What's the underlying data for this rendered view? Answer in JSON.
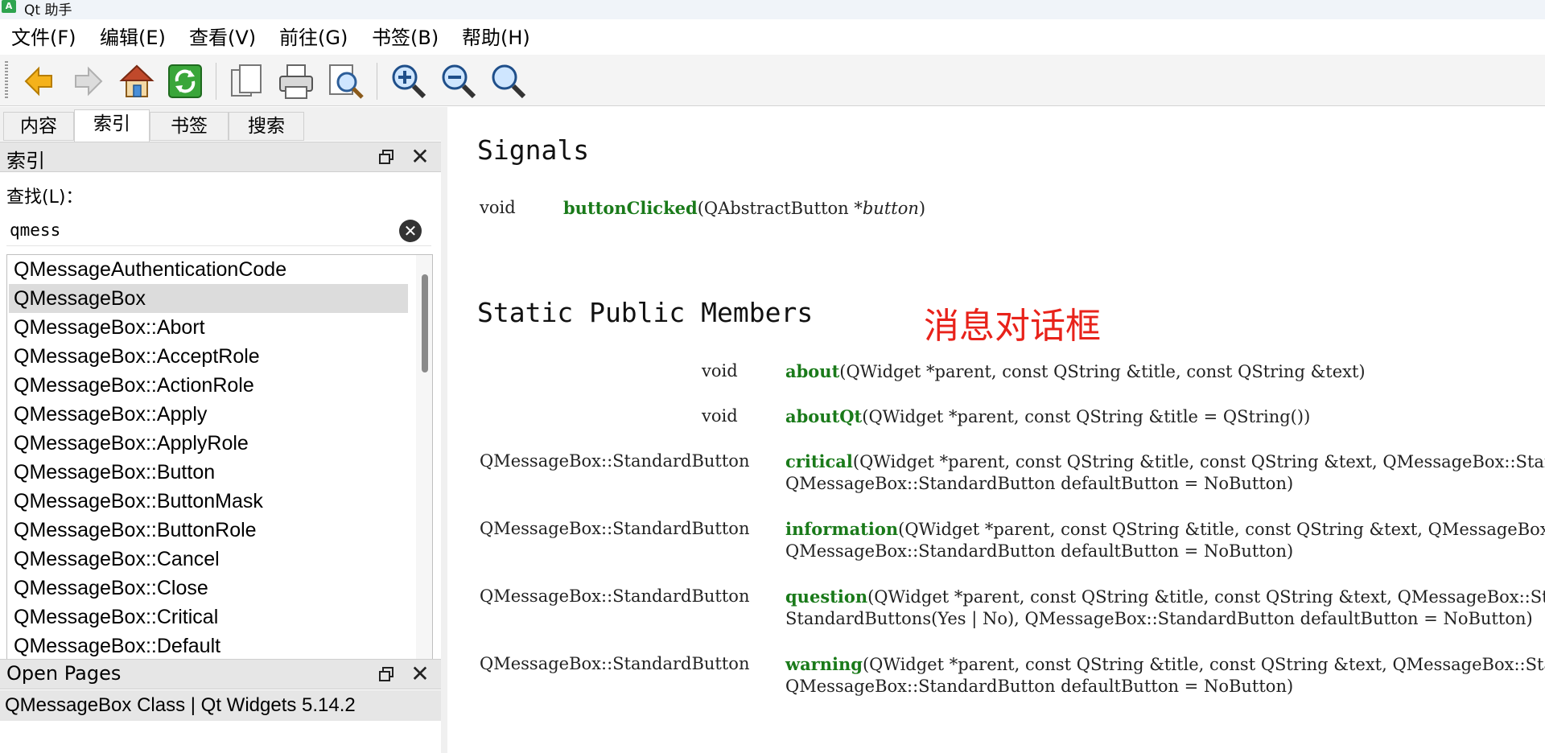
{
  "window": {
    "title": "Qt 助手",
    "app_icon_letter": "A"
  },
  "menu": [
    "文件(F)",
    "编辑(E)",
    "查看(V)",
    "前往(G)",
    "书签(B)",
    "帮助(H)"
  ],
  "toolbar": {
    "buttons": [
      "back-arrow-icon",
      "forward-arrow-icon",
      "home-icon",
      "sync-icon",
      "copy-icon",
      "print-icon",
      "find-icon",
      "zoom-in-icon",
      "zoom-out-icon",
      "zoom-reset-icon"
    ]
  },
  "sidebar": {
    "tabs": [
      "内容",
      "索引",
      "书签",
      "搜索"
    ],
    "active_tab": "索引",
    "index_dock": {
      "title": "索引",
      "find_label": "查找(L)：",
      "search_value": "qmess"
    },
    "index_items": [
      "QMessageAuthenticationCode",
      "QMessageBox",
      "QMessageBox::Abort",
      "QMessageBox::AcceptRole",
      "QMessageBox::ActionRole",
      "QMessageBox::Apply",
      "QMessageBox::ApplyRole",
      "QMessageBox::Button",
      "QMessageBox::ButtonMask",
      "QMessageBox::ButtonRole",
      "QMessageBox::Cancel",
      "QMessageBox::Close",
      "QMessageBox::Critical",
      "QMessageBox::Default"
    ],
    "selected_index": "QMessageBox",
    "open_pages": {
      "title": "Open Pages",
      "items": [
        "QMessageBox Class | Qt Widgets 5.14.2"
      ]
    }
  },
  "doc": {
    "signals_heading": "Signals",
    "signal": {
      "return": "void",
      "name": "buttonClicked",
      "params": "(QAbstractButton *",
      "param_name": "button",
      "close": ")"
    },
    "static_heading": "Static Public Members",
    "annotation": "消息对话框",
    "members": [
      {
        "return": "void",
        "name": "about",
        "line1": "(QWidget *parent, const QString &title, const QString &text)",
        "line2": ""
      },
      {
        "return": "void",
        "name": "aboutQt",
        "line1": "(QWidget *parent, const QString &title = QString())",
        "line2": ""
      },
      {
        "return": "QMessageBox::StandardButton",
        "name": "critical",
        "line1": "(QWidget *parent, const QString &title, const QString &text, QMessageBox::StandardButtons buttons = Ok,",
        "line2": "QMessageBox::StandardButton defaultButton = NoButton)"
      },
      {
        "return": "QMessageBox::StandardButton",
        "name": "information",
        "line1": "(QWidget *parent, const QString &title, const QString &text, QMessageBox::StandardButtons buttons = Ok,",
        "line2": "QMessageBox::StandardButton defaultButton = NoButton)"
      },
      {
        "return": "QMessageBox::StandardButton",
        "name": "question",
        "line1": "(QWidget *parent, const QString &title, const QString &text, QMessageBox::StandardButtons buttons =",
        "line2": "StandardButtons(Yes | No), QMessageBox::StandardButton defaultButton = NoButton)"
      },
      {
        "return": "QMessageBox::StandardButton",
        "name": "warning",
        "line1": "(QWidget *parent, const QString &title, const QString &text, QMessageBox::StandardButtons buttons = Ok,",
        "line2": "QMessageBox::StandardButton defaultButton = NoButton)"
      }
    ]
  },
  "colors": {
    "function_name": "#1a7a1a",
    "annotation": "#e8221a",
    "selected_row": "#dcdcdc"
  }
}
